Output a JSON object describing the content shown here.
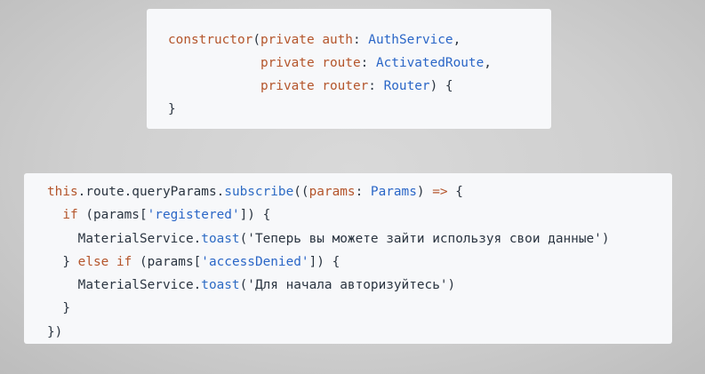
{
  "colors": {
    "keyword": "#b4552b",
    "function": "#2d6bc4",
    "type": "#2a66c7",
    "plain": "#2a3440",
    "panel_bg": "#f7f8fa"
  },
  "top_snippet": {
    "lines": [
      [
        {
          "t": "constructor",
          "c": "kw"
        },
        {
          "t": "(",
          "c": "pl"
        },
        {
          "t": "private",
          "c": "kw"
        },
        {
          "t": " ",
          "c": "pl"
        },
        {
          "t": "auth",
          "c": "kw"
        },
        {
          "t": ": ",
          "c": "pl"
        },
        {
          "t": "AuthService",
          "c": "ty"
        },
        {
          "t": ",",
          "c": "pl"
        }
      ],
      [
        {
          "t": "            ",
          "c": "pl"
        },
        {
          "t": "private",
          "c": "kw"
        },
        {
          "t": " ",
          "c": "pl"
        },
        {
          "t": "route",
          "c": "kw"
        },
        {
          "t": ": ",
          "c": "pl"
        },
        {
          "t": "ActivatedRoute",
          "c": "ty"
        },
        {
          "t": ",",
          "c": "pl"
        }
      ],
      [
        {
          "t": "            ",
          "c": "pl"
        },
        {
          "t": "private",
          "c": "kw"
        },
        {
          "t": " ",
          "c": "pl"
        },
        {
          "t": "router",
          "c": "kw"
        },
        {
          "t": ": ",
          "c": "pl"
        },
        {
          "t": "Router",
          "c": "ty"
        },
        {
          "t": ") {",
          "c": "pl"
        }
      ],
      [
        {
          "t": "}",
          "c": "pl"
        }
      ]
    ]
  },
  "bottom_snippet": {
    "lines": [
      [
        {
          "t": "this",
          "c": "kw"
        },
        {
          "t": ".route.queryParams.",
          "c": "pl"
        },
        {
          "t": "subscribe",
          "c": "fn"
        },
        {
          "t": "((",
          "c": "pl"
        },
        {
          "t": "params",
          "c": "kw"
        },
        {
          "t": ": ",
          "c": "pl"
        },
        {
          "t": "Params",
          "c": "ty"
        },
        {
          "t": ") ",
          "c": "pl"
        },
        {
          "t": "=>",
          "c": "kw"
        },
        {
          "t": " {",
          "c": "pl"
        }
      ],
      [
        {
          "t": "  ",
          "c": "pl"
        },
        {
          "t": "if",
          "c": "kw"
        },
        {
          "t": " (params[",
          "c": "pl"
        },
        {
          "t": "'registered'",
          "c": "ty"
        },
        {
          "t": "]) {",
          "c": "pl"
        }
      ],
      [
        {
          "t": "    MaterialService.",
          "c": "pl"
        },
        {
          "t": "toast",
          "c": "fn"
        },
        {
          "t": "(",
          "c": "pl"
        },
        {
          "t": "'Теперь вы можете зайти используя свои данные'",
          "c": "pl"
        },
        {
          "t": ")",
          "c": "pl"
        }
      ],
      [
        {
          "t": "  } ",
          "c": "pl"
        },
        {
          "t": "else",
          "c": "kw"
        },
        {
          "t": " ",
          "c": "pl"
        },
        {
          "t": "if",
          "c": "kw"
        },
        {
          "t": " (params[",
          "c": "pl"
        },
        {
          "t": "'accessDenied'",
          "c": "ty"
        },
        {
          "t": "]) {",
          "c": "pl"
        }
      ],
      [
        {
          "t": "    MaterialService.",
          "c": "pl"
        },
        {
          "t": "toast",
          "c": "fn"
        },
        {
          "t": "(",
          "c": "pl"
        },
        {
          "t": "'Для начала авторизуйтесь'",
          "c": "pl"
        },
        {
          "t": ")",
          "c": "pl"
        }
      ],
      [
        {
          "t": "  }",
          "c": "pl"
        }
      ],
      [
        {
          "t": "})",
          "c": "pl"
        }
      ]
    ]
  }
}
